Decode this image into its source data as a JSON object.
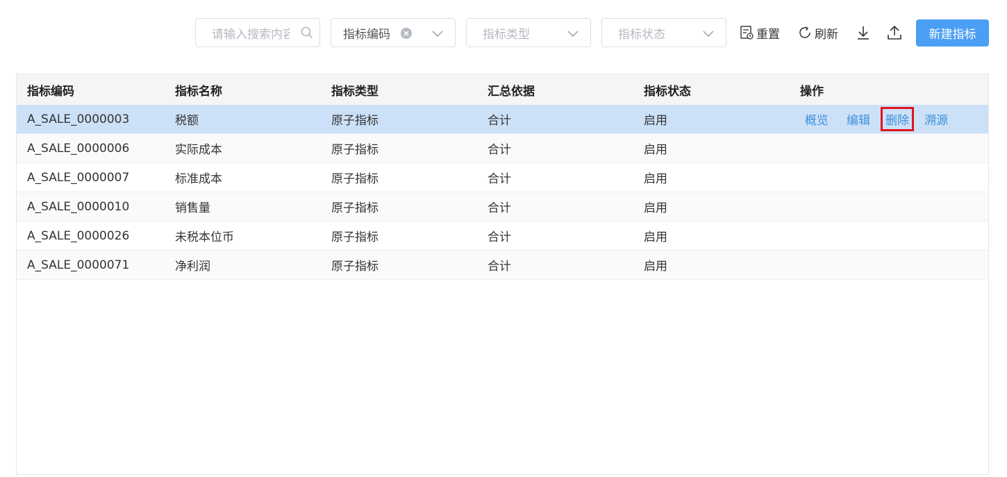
{
  "toolbar": {
    "search_placeholder": "请输入搜索内容",
    "filter_code_value": "指标编码",
    "filter_type_placeholder": "指标类型",
    "filter_status_placeholder": "指标状态",
    "reset_label": "重置",
    "refresh_label": "刷新",
    "new_label": "新建指标"
  },
  "table": {
    "headers": [
      "指标编码",
      "指标名称",
      "指标类型",
      "汇总依据",
      "指标状态",
      "操作"
    ],
    "rows": [
      {
        "code": "A_SALE_0000003",
        "name": "税额",
        "type": "原子指标",
        "basis": "合计",
        "status": "启用"
      },
      {
        "code": "A_SALE_0000006",
        "name": "实际成本",
        "type": "原子指标",
        "basis": "合计",
        "status": "启用"
      },
      {
        "code": "A_SALE_0000007",
        "name": "标准成本",
        "type": "原子指标",
        "basis": "合计",
        "status": "启用"
      },
      {
        "code": "A_SALE_0000010",
        "name": "销售量",
        "type": "原子指标",
        "basis": "合计",
        "status": "启用"
      },
      {
        "code": "A_SALE_0000026",
        "name": "未税本位币",
        "type": "原子指标",
        "basis": "合计",
        "status": "启用"
      },
      {
        "code": "A_SALE_0000071",
        "name": "净利润",
        "type": "原子指标",
        "basis": "合计",
        "status": "启用"
      }
    ],
    "actions": [
      "概览",
      "编辑",
      "删除",
      "溯源"
    ]
  },
  "colors": {
    "primary": "#4a9ff5",
    "link": "#3d8fdc",
    "selected_row": "#cce1f8",
    "highlight": "#e0141e"
  }
}
